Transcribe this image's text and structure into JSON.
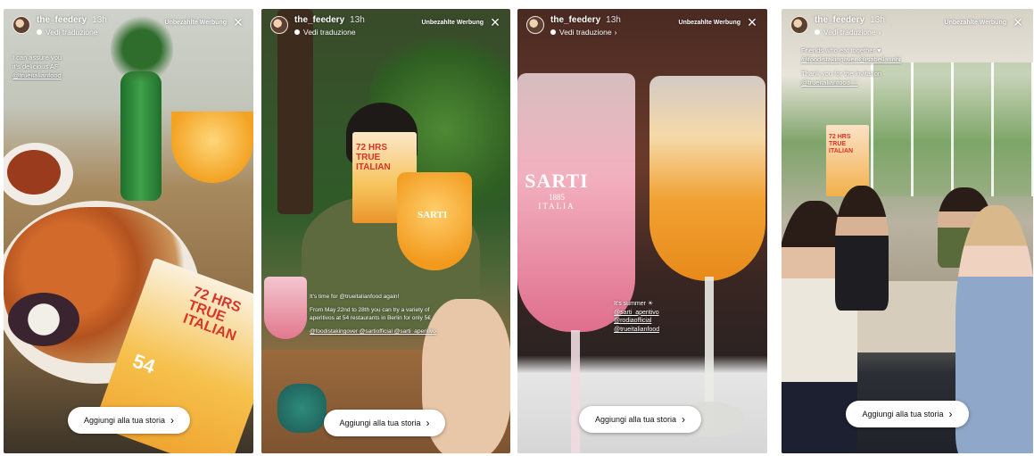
{
  "stories": [
    {
      "username": "the_feedery",
      "time": "13h",
      "translate_label": "Vedi traduzione",
      "location": "Unbezahlte Werbung",
      "caption_lines": [
        "I can assure you",
        "it's delicious AF",
        "@trueitalianfood"
      ],
      "sticker_text": "72 HRS TRUE ITALIAN",
      "sticker_number": "54",
      "add_label": "Aggiungi alla tua storia"
    },
    {
      "username": "the_feedery",
      "time": "13h",
      "translate_label": "Vedi traduzione",
      "location": "Unbezahlte Werbung",
      "caption_lines": [
        "It's time for @trueitalianfood again!",
        "From May 22nd to 28th you can try a variety of",
        "aperitivos at 54 restaurants in Berlin for only 5€",
        "@foodistakingover @sartiofficial @sarti_aperitivo"
      ],
      "sticker_text": "72 HRS TRUE ITALIAN",
      "glass_brand": "SARTI",
      "add_label": "Aggiungi alla tua storia"
    },
    {
      "username": "the_feedery",
      "time": "13h",
      "translate_label": "Vedi traduzione",
      "location": "Unbezahlte Werbung",
      "caption_lines": [
        "It's summer ☀",
        "@sarti_aperitivo",
        "@rodiaofficial",
        "@trueitalianfood"
      ],
      "glass_brand": "SARTI",
      "glass_year": "1885",
      "glass_sub": "ITALIA",
      "add_label": "Aggiungi alla tua storia"
    },
    {
      "username": "the_feedery",
      "time": "13h",
      "translate_label": "Vedi traduzione",
      "location": "Unbezahlte Werbung",
      "caption_lines": [
        "Friends who eat together ♥",
        "@foodistakingover @isabellannhi",
        "",
        "Thank you for the invitation",
        "@trueitalianfood ♡"
      ],
      "poster_text": "72 HRS TRUE ITALIAN",
      "add_label": "Aggiungi alla tua storia"
    }
  ],
  "icons": {
    "close": "×",
    "chevron_right": "›",
    "dot": "●"
  },
  "colors": {
    "button_bg": "#ffffff",
    "button_text": "#111111",
    "spritz_orange": "#f3a323",
    "rose_pink": "#e98aa2",
    "foliage_green": "#3e6b2e"
  }
}
